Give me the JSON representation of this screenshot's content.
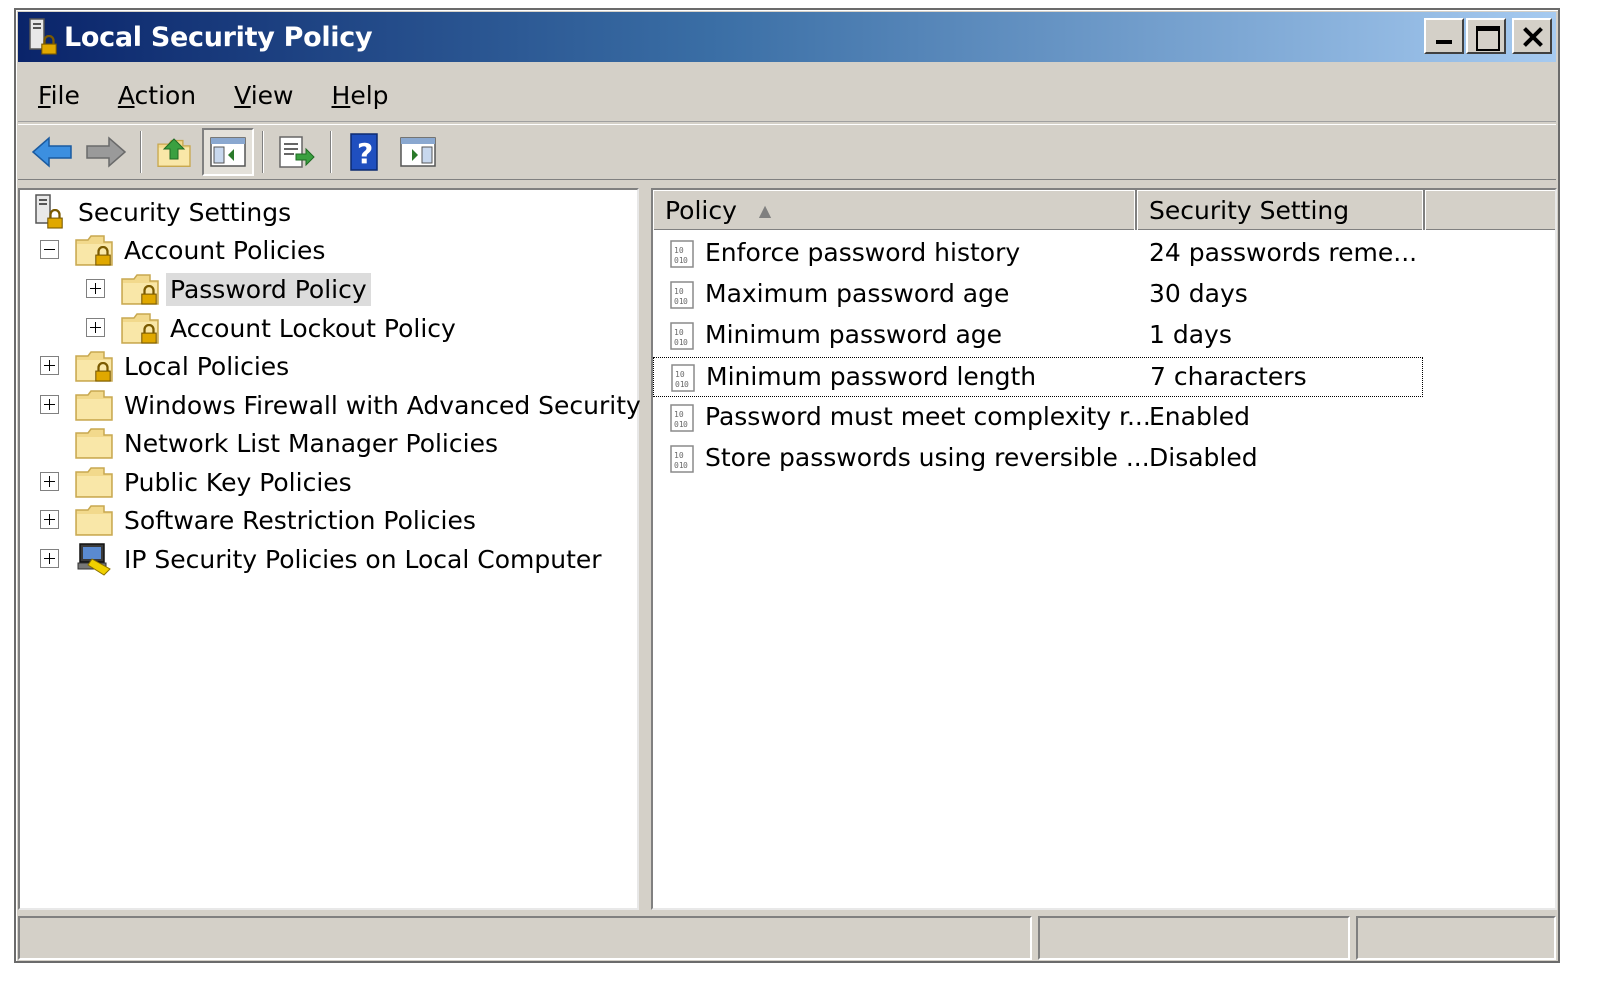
{
  "window": {
    "title": "Local Security Policy"
  },
  "menu": {
    "items": [
      {
        "accel": "F",
        "rest": "ile"
      },
      {
        "accel": "A",
        "rest": "ction"
      },
      {
        "accel": "V",
        "rest": "iew"
      },
      {
        "accel": "H",
        "rest": "elp"
      }
    ]
  },
  "toolbar": {
    "buttons": [
      "back-icon",
      "forward-icon",
      "up-folder-icon",
      "show-hide-console-tree-icon",
      "export-list-icon",
      "help-icon",
      "action-pane-icon"
    ]
  },
  "tree": {
    "root": "Security Settings",
    "account_policies": "Account Policies",
    "password_policy": "Password Policy",
    "account_lockout_policy": "Account Lockout Policy",
    "local_policies": "Local Policies",
    "windows_firewall": "Windows Firewall with Advanced Security",
    "network_list_manager": "Network List Manager Policies",
    "public_key": "Public Key Policies",
    "software_restriction": "Software Restriction Policies",
    "ip_security": "IP Security Policies on Local Computer"
  },
  "list": {
    "columns": {
      "policy": "Policy",
      "setting": "Security Setting"
    },
    "rows": [
      {
        "policy": "Enforce password history",
        "setting": "24 passwords reme..."
      },
      {
        "policy": "Maximum password age",
        "setting": "30 days"
      },
      {
        "policy": "Minimum password age",
        "setting": "1 days"
      },
      {
        "policy": "Minimum password length",
        "setting": "7 characters"
      },
      {
        "policy": "Password must meet complexity r...",
        "setting": "Enabled"
      },
      {
        "policy": "Store passwords using reversible ...",
        "setting": "Disabled"
      }
    ]
  },
  "colors": {
    "titlebar_start": "#0a246a",
    "titlebar_end": "#a6caf0",
    "chrome": "#d4d0c8",
    "folder": "#f2d98c"
  }
}
